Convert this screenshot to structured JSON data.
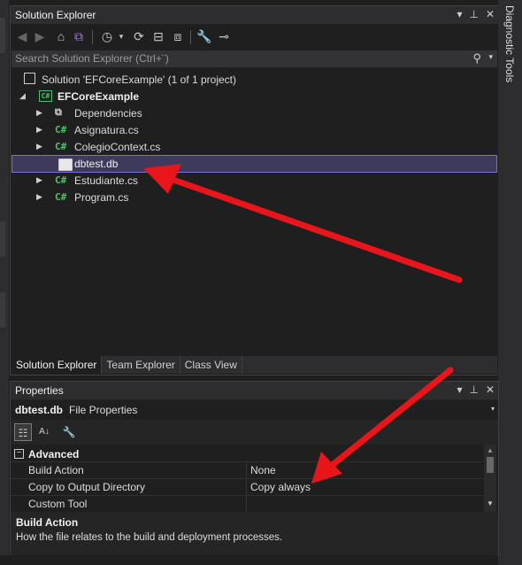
{
  "solution_explorer": {
    "title": "Solution Explorer",
    "search_placeholder": "Search Solution Explorer (Ctrl+¨)",
    "tree": {
      "solution": "Solution 'EFCoreExample' (1 of 1 project)",
      "project": "EFCoreExample",
      "items": [
        {
          "label": "Dependencies",
          "icon": "dependencies-icon"
        },
        {
          "label": "Asignatura.cs",
          "icon": "csharp-file-icon"
        },
        {
          "label": "ColegioContext.cs",
          "icon": "csharp-file-icon"
        },
        {
          "label": "dbtest.db",
          "icon": "database-file-icon"
        },
        {
          "label": "Estudiante.cs",
          "icon": "csharp-file-icon"
        },
        {
          "label": "Program.cs",
          "icon": "csharp-file-icon"
        }
      ],
      "cs_glyph": "C#"
    },
    "tabs": [
      "Solution Explorer",
      "Team Explorer",
      "Class View"
    ]
  },
  "side_panel": {
    "label": "Diagnostic Tools"
  },
  "properties": {
    "title": "Properties",
    "object_name": "dbtest.db",
    "object_type": "File Properties",
    "category": "Advanced",
    "rows": [
      {
        "key": "Build Action",
        "value": "None"
      },
      {
        "key": "Copy to Output Directory",
        "value": "Copy always"
      },
      {
        "key": "Custom Tool",
        "value": ""
      }
    ],
    "description_title": "Build Action",
    "description_text": "How the file relates to the build and deployment processes."
  },
  "colors": {
    "background": "#1f1f1f",
    "selection": "#3e3a5c",
    "selection_border": "#7a6ee0",
    "csharp_green": "#4ec26a",
    "annotation_arrow": "#e8151b"
  }
}
